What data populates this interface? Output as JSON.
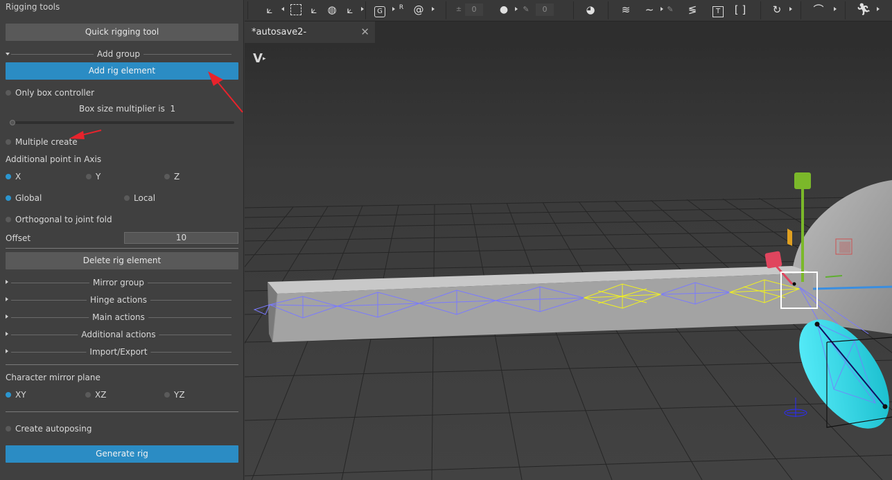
{
  "panel": {
    "title": "Rigging tools",
    "quick_rigging_button": "Quick rigging tool",
    "add_group_label": "Add group",
    "add_rig_element_button": "Add rig element",
    "only_box_controller": "Only box controller",
    "box_size_multiplier_label": "Box size multiplier is",
    "box_size_multiplier_value": "1",
    "box_size_slider_value": 0.0,
    "multiple_create": "Multiple create",
    "additional_point_label": "Additional point in Axis",
    "axis_options": [
      "X",
      "Y",
      "Z"
    ],
    "axis_selected": "X",
    "space_options": [
      "Global",
      "Local"
    ],
    "space_selected": "Global",
    "orthogonal_label": "Orthogonal to joint fold",
    "offset_label": "Offset",
    "offset_value": "10",
    "delete_rig_element_button": "Delete rig element",
    "sections": [
      "Mirror group",
      "Hinge actions",
      "Main actions",
      "Additional actions",
      "Import/Export"
    ],
    "mirror_plane_label": "Character mirror plane",
    "mirror_plane_options": [
      "XY",
      "XZ",
      "YZ"
    ],
    "mirror_plane_selected": "XY",
    "create_autoposing": "Create autoposing",
    "generate_rig_button": "Generate rig"
  },
  "toolbar": {
    "num_field_1": "0",
    "num_field_2": "0"
  },
  "document": {
    "tab_title": "*autosave2-"
  },
  "viewport": {
    "logo_icon": "v-logo-icon"
  },
  "colors": {
    "accent": "#2b8cc4",
    "annotation_arrow": "#e8232c",
    "bone_blue": "#7a7aff",
    "bone_yellow": "#f0f020",
    "cyan_object": "#2ee0f0"
  }
}
